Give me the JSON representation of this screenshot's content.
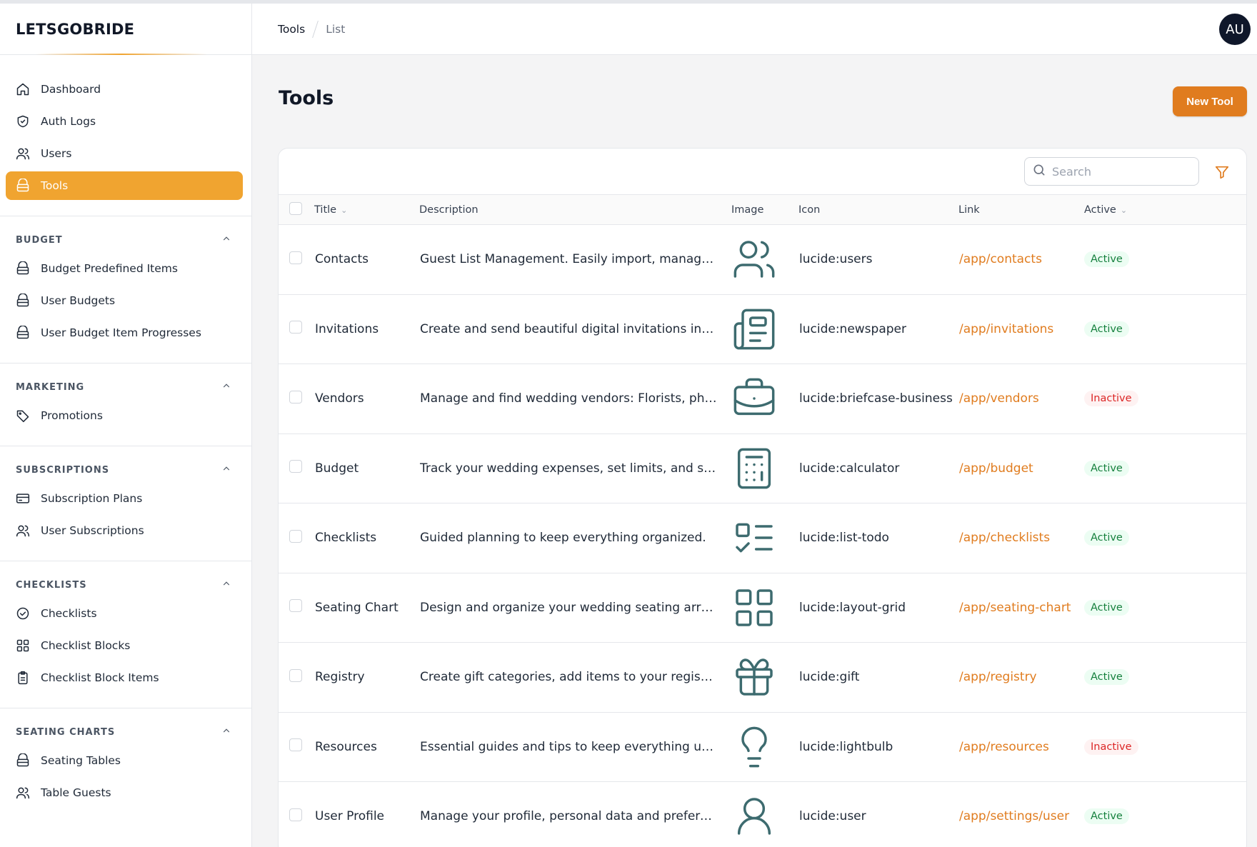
{
  "brand": "LETSGOBRIDE",
  "colors": {
    "accent": "#f0a430",
    "primary_button": "#e07c1f",
    "link": "#e07c1f",
    "icon_stroke": "#3d6b6f"
  },
  "nav": [
    {
      "label": "Dashboard",
      "icon": "home-icon"
    },
    {
      "label": "Auth Logs",
      "icon": "shield-check-icon"
    },
    {
      "label": "Users",
      "icon": "users-icon"
    },
    {
      "label": "Tools",
      "icon": "box-icon",
      "active": true
    }
  ],
  "sections": [
    {
      "title": "BUDGET",
      "items": [
        {
          "label": "Budget Predefined Items",
          "icon": "box-icon"
        },
        {
          "label": "User Budgets",
          "icon": "box-icon"
        },
        {
          "label": "User Budget Item Progresses",
          "icon": "box-icon"
        }
      ]
    },
    {
      "title": "MARKETING",
      "items": [
        {
          "label": "Promotions",
          "icon": "tag-icon"
        }
      ]
    },
    {
      "title": "SUBSCRIPTIONS",
      "items": [
        {
          "label": "Subscription Plans",
          "icon": "credit-card-icon"
        },
        {
          "label": "User Subscriptions",
          "icon": "users-icon"
        }
      ]
    },
    {
      "title": "CHECKLISTS",
      "items": [
        {
          "label": "Checklists",
          "icon": "circle-check-icon"
        },
        {
          "label": "Checklist Blocks",
          "icon": "grid-icon"
        },
        {
          "label": "Checklist Block Items",
          "icon": "clipboard-icon"
        }
      ]
    },
    {
      "title": "SEATING CHARTS",
      "items": [
        {
          "label": "Seating Tables",
          "icon": "box-icon"
        },
        {
          "label": "Table Guests",
          "icon": "users-icon"
        }
      ]
    }
  ],
  "breadcrumb": {
    "first": "Tools",
    "second": "List"
  },
  "user": {
    "initials": "AU"
  },
  "page": {
    "title": "Tools",
    "new_button": "New Tool"
  },
  "search": {
    "placeholder": "Search"
  },
  "table": {
    "headers": {
      "title": "Title",
      "description": "Description",
      "image": "Image",
      "icon": "Icon",
      "link": "Link",
      "active": "Active"
    },
    "rows": [
      {
        "title": "Contacts",
        "description": "Guest List Management. Easily import, manage and t...",
        "image": "users",
        "icon": "lucide:users",
        "link": "/app/contacts",
        "status": "Active"
      },
      {
        "title": "Invitations",
        "description": "Create and send beautiful digital invitations in m...",
        "image": "newspaper",
        "icon": "lucide:newspaper",
        "link": "/app/invitations",
        "status": "Active"
      },
      {
        "title": "Vendors",
        "description": "Manage and find wedding vendors: Florists, photogr...",
        "image": "briefcase",
        "icon": "lucide:briefcase-business",
        "link": "/app/vendors",
        "status": "Inactive"
      },
      {
        "title": "Budget",
        "description": "Track your wedding expenses, set limits, and stay...",
        "image": "calculator",
        "icon": "lucide:calculator",
        "link": "/app/budget",
        "status": "Active"
      },
      {
        "title": "Checklists",
        "description": "Guided planning to keep everything organized.",
        "image": "list-todo",
        "icon": "lucide:list-todo",
        "link": "/app/checklists",
        "status": "Active"
      },
      {
        "title": "Seating Chart",
        "description": "Design and organize your wedding seating arrangeme...",
        "image": "layout-grid",
        "icon": "lucide:layout-grid",
        "link": "/app/seating-chart",
        "status": "Active"
      },
      {
        "title": "Registry",
        "description": "Create gift categories, add items to your registry...",
        "image": "gift",
        "icon": "lucide:gift",
        "link": "/app/registry",
        "status": "Active"
      },
      {
        "title": "Resources",
        "description": "Essential guides and tips to keep everything under...",
        "image": "lightbulb",
        "icon": "lucide:lightbulb",
        "link": "/app/resources",
        "status": "Inactive"
      },
      {
        "title": "User Profile",
        "description": "Manage your profile, personal data and preferences...",
        "image": "user",
        "icon": "lucide:user",
        "link": "/app/settings/user",
        "status": "Active"
      }
    ]
  }
}
